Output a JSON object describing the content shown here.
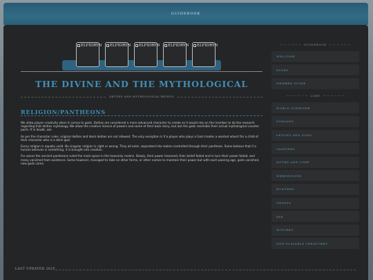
{
  "topbar": {
    "title": "GUIDEBOOK"
  },
  "gallery": {
    "images": [
      {
        "alt": "ELFIDRYN"
      },
      {
        "alt": "ELFIDRYN"
      },
      {
        "alt": "ELFIDRYN"
      },
      {
        "alt": "ELFIDRYN"
      },
      {
        "alt": "ELFIDRYN"
      }
    ]
  },
  "page": {
    "title": "THE DIVINE AND THE MYTHOLOGICAL",
    "subtitle": "DEITIES AND MYTHOLOGICAL BEINGS"
  },
  "section": {
    "heading": "RELIGION/PANTHEONS",
    "paragraphs": [
      "We allow player creativity when it comes to gods. Deities are considered a more advanced character to create so it would rely on the member to do the research regarding that deities mythology. We allow the creative licence of powers and some of their back story, but ask the gods resemble their actual mythological counter parts. If in doubt, ask.",
      "As per the character rules, original deities and demi deities are not allowed. The only exception is if a player who plays a God creates a wanted advert for a child of their character who is a demi god.",
      "Every religion is equally valid. No singular religion is right or wrong. They all exist, separated into realms controlled through their pantheon. Some believe that if a human believes in something, it is brought into creation.",
      "For aeons the ancient pantheons ruled the most space in the heavenly realms. Slowly, their power lessened, their belief faded and in turn their power faded, and many vanished from existence. Some however, managed to take on other forms, or other names to maintain their power but with each passing age, gods vanished, new gods came."
    ]
  },
  "sidebar": {
    "heading1": "GUIDEBOOK",
    "group1": [
      "WELCOME",
      "RULES",
      "MEMBER GUIDE"
    ],
    "heading2": "LORE",
    "group2": [
      "WORLD OVERVIEW",
      "DOMAINS",
      "DEITIES AND GODS",
      "VAMPIRES",
      "MYTHS AND LORE",
      "WEREWOLVES",
      "HUNTERS",
      "GHOSTS",
      "FAE",
      "WITCHES",
      "NON-PLAYABLE CREATURES"
    ]
  },
  "footer": {
    "text": "LAST UPDATED 2025"
  }
}
